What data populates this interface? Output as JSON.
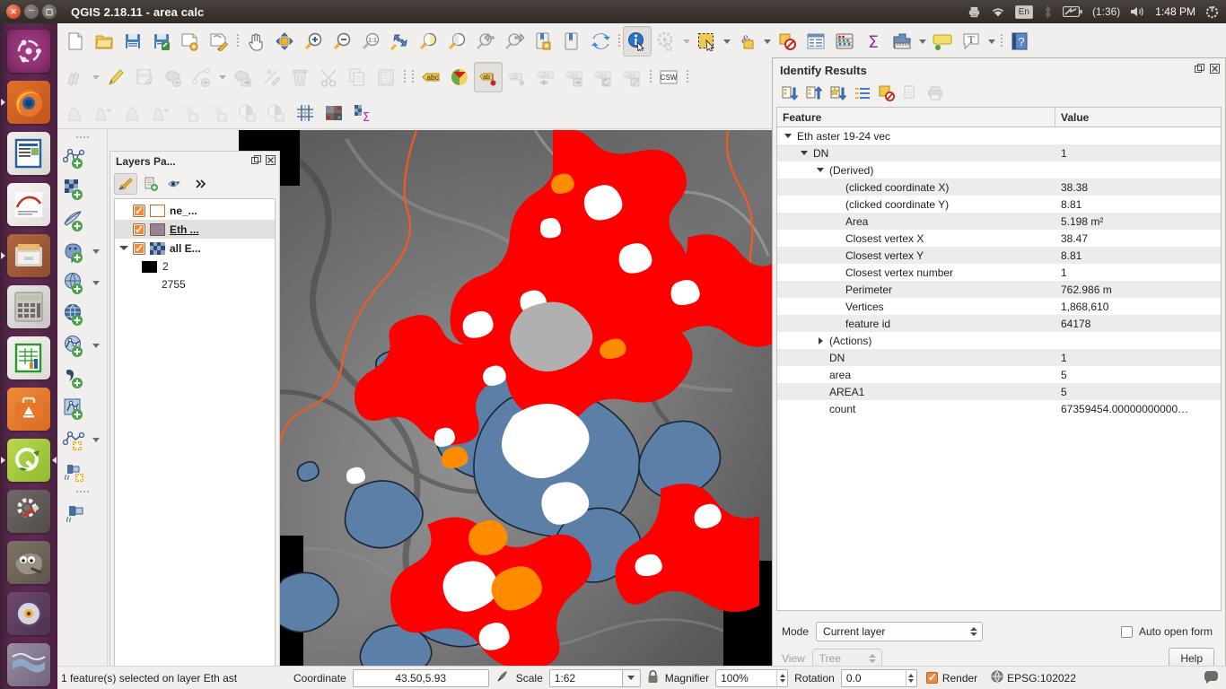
{
  "desktop": {
    "window_title": "QGIS 2.18.11 - area calc",
    "window_buttons": {
      "close": "close-button",
      "minimize": "minimize-button",
      "maximize": "maximize-button"
    },
    "tray": {
      "printer_icon": "printer-icon",
      "wifi_icon": "wifi-icon",
      "keyboard_layout": "En",
      "bluetooth_icon": "bluetooth-icon",
      "battery_icon": "battery-icon",
      "battery_time": "(1:36)",
      "volume_icon": "volume-icon",
      "clock": "1:48 PM",
      "power_icon": "power-gear-icon"
    }
  },
  "launcher": {
    "items": [
      {
        "name": "ubuntu-dash",
        "glyph": "◉"
      },
      {
        "name": "firefox",
        "glyph": "🦊"
      },
      {
        "name": "libreoffice-writer",
        "glyph": "▤"
      },
      {
        "name": "libreoffice-draw",
        "glyph": "✎"
      },
      {
        "name": "files",
        "glyph": "🗄"
      },
      {
        "name": "calculator",
        "glyph": "▦"
      },
      {
        "name": "libreoffice-calc",
        "glyph": "▦"
      },
      {
        "name": "ubuntu-software",
        "glyph": "A"
      },
      {
        "name": "qgis",
        "glyph": "Q"
      },
      {
        "name": "system-settings",
        "glyph": "⚙"
      },
      {
        "name": "gimp",
        "glyph": "🖌"
      },
      {
        "name": "disc-burner",
        "glyph": "◎"
      },
      {
        "name": "file-manager",
        "glyph": "≋"
      }
    ]
  },
  "toolbars": {
    "row1": [
      {
        "name": "new-project-button",
        "type": "icon"
      },
      {
        "name": "open-project-button",
        "type": "icon"
      },
      {
        "name": "save-project-button",
        "type": "icon"
      },
      {
        "name": "save-project-as-button",
        "type": "icon"
      },
      {
        "name": "new-print-composer-button",
        "type": "icon"
      },
      {
        "name": "composer-manager-button",
        "type": "icon"
      },
      {
        "name": "separator",
        "type": "sep"
      },
      {
        "name": "pan-map-button",
        "type": "icon"
      },
      {
        "name": "pan-map-to-selection-button",
        "type": "icon"
      },
      {
        "name": "zoom-in-button",
        "type": "icon"
      },
      {
        "name": "zoom-out-button",
        "type": "icon"
      },
      {
        "name": "zoom-native-resolution-button",
        "type": "icon"
      },
      {
        "name": "zoom-full-button",
        "type": "icon"
      },
      {
        "name": "zoom-to-selection-button",
        "type": "icon"
      },
      {
        "name": "zoom-to-layer-button",
        "type": "icon"
      },
      {
        "name": "zoom-last-button",
        "type": "icon"
      },
      {
        "name": "zoom-next-button",
        "type": "icon"
      },
      {
        "name": "new-bookmark-button",
        "type": "icon"
      },
      {
        "name": "show-bookmarks-button",
        "type": "icon"
      },
      {
        "name": "refresh-button",
        "type": "icon"
      },
      {
        "name": "separator",
        "type": "sep"
      },
      {
        "name": "identify-features-button",
        "type": "icon",
        "active": true
      },
      {
        "name": "run-feature-action-button",
        "type": "icon",
        "disabled": true
      },
      {
        "name": "run-feature-action-dropdown",
        "type": "arrow",
        "disabled": true
      },
      {
        "name": "select-features-button",
        "type": "icon"
      },
      {
        "name": "select-features-dropdown",
        "type": "arrow"
      },
      {
        "name": "select-by-expression-button",
        "type": "icon"
      },
      {
        "name": "deselect-features-dropdown",
        "type": "arrow"
      },
      {
        "name": "deselect-features-button",
        "type": "icon"
      },
      {
        "name": "open-attribute-table-button",
        "type": "icon"
      },
      {
        "name": "field-calculator-button",
        "type": "icon"
      },
      {
        "name": "statistical-summary-button",
        "type": "icon"
      },
      {
        "name": "measure-line-button",
        "type": "icon"
      },
      {
        "name": "measure-dropdown",
        "type": "arrow"
      },
      {
        "name": "map-tips-button",
        "type": "icon"
      },
      {
        "name": "new-text-annotation-button",
        "type": "icon"
      },
      {
        "name": "annotation-dropdown",
        "type": "arrow"
      },
      {
        "name": "separator",
        "type": "sep"
      },
      {
        "name": "help-contents-button",
        "type": "icon"
      }
    ],
    "row2": [
      {
        "name": "current-edits-button",
        "type": "icon",
        "disabled": true
      },
      {
        "name": "current-edits-dropdown",
        "type": "arrow",
        "disabled": true
      },
      {
        "name": "toggle-editing-button",
        "type": "icon",
        "disabled": true
      },
      {
        "name": "save-layer-edits-button",
        "type": "icon",
        "disabled": true
      },
      {
        "name": "add-feature-button",
        "type": "icon",
        "disabled": true
      },
      {
        "name": "add-circular-string-button",
        "type": "icon",
        "disabled": true
      },
      {
        "name": "digitize-dropdown",
        "type": "arrow",
        "disabled": true
      },
      {
        "name": "move-feature-button",
        "type": "icon",
        "disabled": true
      },
      {
        "name": "node-tool-button",
        "type": "icon",
        "disabled": true
      },
      {
        "name": "delete-selected-button",
        "type": "icon",
        "disabled": true
      },
      {
        "name": "cut-features-button",
        "type": "icon",
        "disabled": true
      },
      {
        "name": "copy-features-button",
        "type": "icon",
        "disabled": true
      },
      {
        "name": "paste-features-button",
        "type": "icon",
        "disabled": true
      },
      {
        "name": "separator",
        "type": "sep"
      },
      {
        "name": "label-toolbar-grip",
        "type": "sep"
      },
      {
        "name": "layer-labeling-options-button",
        "type": "icon"
      },
      {
        "name": "style-manager-button",
        "type": "icon"
      },
      {
        "name": "pin-labels-button",
        "type": "icon",
        "active": true
      },
      {
        "name": "highlight-pinned-labels-button",
        "type": "icon",
        "disabled": true
      },
      {
        "name": "show-hide-labels-button",
        "type": "icon",
        "disabled": true
      },
      {
        "name": "move-label-button",
        "type": "icon",
        "disabled": true
      },
      {
        "name": "rotate-label-button",
        "type": "icon",
        "disabled": true
      },
      {
        "name": "change-label-button",
        "type": "icon",
        "disabled": true
      },
      {
        "name": "separator",
        "type": "sep"
      },
      {
        "name": "metasearch-csw-button",
        "type": "icon"
      },
      {
        "name": "separator",
        "type": "sep"
      }
    ],
    "row3": [
      {
        "name": "raster-histogram-stretch-button",
        "type": "icon",
        "disabled": true
      },
      {
        "name": "raster-cumulative-stretch-button",
        "type": "icon",
        "disabled": true
      },
      {
        "name": "raster-local-histogram-button",
        "type": "icon",
        "disabled": true
      },
      {
        "name": "raster-local-cumulative-button",
        "type": "icon",
        "disabled": true
      },
      {
        "name": "increase-brightness-button",
        "type": "icon",
        "disabled": true
      },
      {
        "name": "decrease-brightness-button",
        "type": "icon",
        "disabled": true
      },
      {
        "name": "increase-contrast-button",
        "type": "icon",
        "disabled": true
      },
      {
        "name": "decrease-contrast-button",
        "type": "icon",
        "disabled": true
      },
      {
        "name": "vector-grid-button",
        "type": "icon"
      },
      {
        "name": "raster-analysis-button",
        "type": "icon"
      },
      {
        "name": "zonal-statistics-button",
        "type": "icon"
      }
    ],
    "vertical": [
      {
        "name": "grip",
        "type": "grip"
      },
      {
        "name": "add-vector-layer-button",
        "type": "icon"
      },
      {
        "name": "add-raster-layer-button",
        "type": "icon"
      },
      {
        "name": "add-delimited-text-layer-button",
        "type": "icon"
      },
      {
        "name": "add-postgis-layer-button",
        "type": "icon",
        "arrow": true
      },
      {
        "name": "add-spatialite-layer-button",
        "type": "icon",
        "arrow": true
      },
      {
        "name": "add-wms-layer-button",
        "type": "icon"
      },
      {
        "name": "add-wfs-layer-button",
        "type": "icon",
        "arrow": true
      },
      {
        "name": "add-virtual-layer-button",
        "type": "icon"
      },
      {
        "name": "new-shapefile-layer-button",
        "type": "icon"
      },
      {
        "name": "new-memory-layer-button",
        "type": "icon",
        "arrow": true
      },
      {
        "name": "open-data-source-manager-button",
        "type": "icon"
      },
      {
        "name": "grip2",
        "type": "grip"
      },
      {
        "name": "gps-information-button",
        "type": "icon"
      }
    ]
  },
  "layers_panel": {
    "title": "Layers Pa...",
    "undock_icon": "undock-icon",
    "close_icon": "close-icon",
    "toolbar": [
      {
        "name": "open-layer-styling-panel-button",
        "icon": "paintbrush-icon",
        "active": true
      },
      {
        "name": "add-group-button",
        "icon": "add-group-icon"
      },
      {
        "name": "manage-layer-visibility-button",
        "icon": "eye-icon",
        "arrow": true
      },
      {
        "name": "expand-toolbar-button",
        "icon": "chevron-double-right-icon"
      }
    ],
    "layers": [
      {
        "name": "ne_...",
        "symbol": "poly-hollow",
        "checked": true,
        "selected": false,
        "expandable": false
      },
      {
        "name": "Eth ...",
        "symbol": "poly-mauve",
        "checked": true,
        "selected": true,
        "expandable": false
      },
      {
        "name": "all E...",
        "symbol": "raster",
        "checked": true,
        "selected": false,
        "expandable": true
      }
    ],
    "legend_entries": [
      {
        "swatch_color": "#000000",
        "label": "2"
      },
      {
        "swatch_color": null,
        "label": "2755"
      }
    ]
  },
  "identify_results": {
    "title": "Identify Results",
    "undock_icon": "undock-icon",
    "close_icon": "close-icon",
    "toolbar": [
      {
        "name": "expand-new-button",
        "icon": "expand-tree-icon"
      },
      {
        "name": "collapse-all-button",
        "icon": "collapse-tree-icon"
      },
      {
        "name": "expand-all-button",
        "icon": "expand-all-icon"
      },
      {
        "name": "default-view-button",
        "icon": "list-view-icon"
      },
      {
        "name": "clear-results-button",
        "icon": "clear-results-icon"
      },
      {
        "name": "copy-feature-button",
        "icon": "copy-icon",
        "disabled": true
      },
      {
        "name": "print-button",
        "icon": "printer-icon",
        "disabled": true
      }
    ],
    "columns": {
      "feature": "Feature",
      "value": "Value"
    },
    "rows": [
      {
        "indent": 0,
        "twisty": "down",
        "label": "Eth aster 19-24 vec",
        "value": ""
      },
      {
        "indent": 1,
        "twisty": "down",
        "label": "DN",
        "value": "1"
      },
      {
        "indent": 2,
        "twisty": "down",
        "label": "(Derived)",
        "value": ""
      },
      {
        "indent": 3,
        "twisty": "none",
        "label": "(clicked coordinate X)",
        "value": "38.38"
      },
      {
        "indent": 3,
        "twisty": "none",
        "label": "(clicked coordinate Y)",
        "value": "8.81"
      },
      {
        "indent": 3,
        "twisty": "none",
        "label": "Area",
        "value": "5.198 m²"
      },
      {
        "indent": 3,
        "twisty": "none",
        "label": "Closest vertex X",
        "value": "38.47"
      },
      {
        "indent": 3,
        "twisty": "none",
        "label": "Closest vertex Y",
        "value": "8.81"
      },
      {
        "indent": 3,
        "twisty": "none",
        "label": "Closest vertex number",
        "value": "1"
      },
      {
        "indent": 3,
        "twisty": "none",
        "label": "Perimeter",
        "value": "762.986 m"
      },
      {
        "indent": 3,
        "twisty": "none",
        "label": "Vertices",
        "value": "1,868,610"
      },
      {
        "indent": 3,
        "twisty": "none",
        "label": "feature id",
        "value": "64178"
      },
      {
        "indent": 2,
        "twisty": "right",
        "label": "(Actions)",
        "value": ""
      },
      {
        "indent": 2,
        "twisty": "none",
        "label": "DN",
        "value": "1"
      },
      {
        "indent": 2,
        "twisty": "none",
        "label": "area",
        "value": "5"
      },
      {
        "indent": 2,
        "twisty": "none",
        "label": "AREA1",
        "value": "5"
      },
      {
        "indent": 2,
        "twisty": "none",
        "label": "count",
        "value": "67359454.00000000000…"
      }
    ],
    "footer": {
      "mode_label": "Mode",
      "mode_value": "Current layer",
      "view_label": "View",
      "view_value": "Tree",
      "auto_open_form_label": "Auto open form",
      "auto_open_form_checked": false,
      "help_label": "Help"
    }
  },
  "status_bar": {
    "message": "1 feature(s) selected on layer Eth ast",
    "coordinate_label": "Coordinate",
    "coordinate_value": "43.50,5.93",
    "toggle_extents_icon": "toggle-extents-icon",
    "scale_label": "Scale",
    "scale_value": "1:62",
    "lock_icon": "lock-icon",
    "magnifier_label": "Magnifier",
    "magnifier_value": "100%",
    "rotation_label": "Rotation",
    "rotation_value": "0.0",
    "render_label": "Render",
    "render_checked": true,
    "crs_label": "EPSG:102022",
    "crs_icon": "globe-icon",
    "messages_icon": "message-bubble-icon"
  },
  "map": {
    "basemap": "grayscale-hillshade-raster",
    "colors": {
      "red_class": "#ff0000",
      "orange_class": "#ff8c00",
      "blue_class": "#5b7fa6",
      "white_class": "#ffffff",
      "gray_class": "#b0b0b0",
      "boundary_line": "#f15a22",
      "nodata": "#000000"
    }
  }
}
